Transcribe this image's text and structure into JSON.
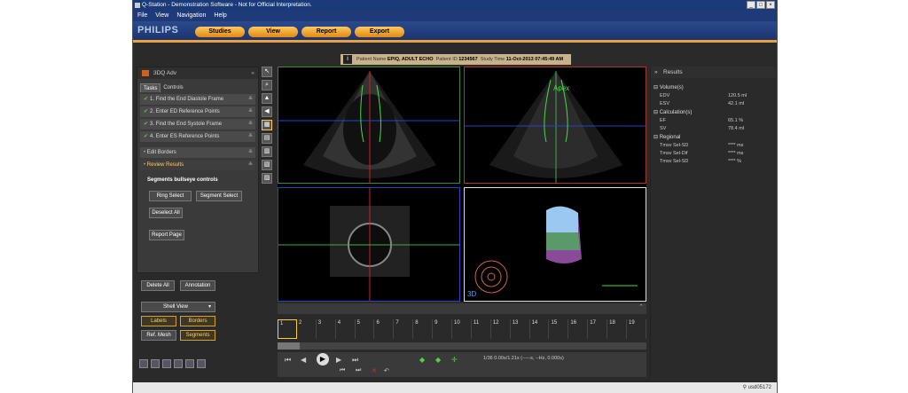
{
  "window": {
    "title": "Q-Station - Demonstration Software - Not for Official Interpretation."
  },
  "menu": [
    "File",
    "View",
    "Navigation",
    "Help"
  ],
  "brand": {
    "logo": "PHILIPS"
  },
  "main_tabs": [
    "Studies",
    "View",
    "Report",
    "Export"
  ],
  "patient": {
    "name_label": "Patient Name",
    "name": "EPIQ, ADULT ECHO",
    "id_label": "Patient ID",
    "id": "1234567",
    "time_label": "Study Time",
    "time": "11-Oct-2013 07:45:49 AM"
  },
  "left_panel": {
    "title": "3DQ Adv",
    "tabs": [
      "Tasks",
      "Controls"
    ],
    "tasks": [
      "1. Find the End Diastole Frame",
      "2. Enter ED Reference Points",
      "3. Find the End Systole Frame",
      "4. Enter ES Reference Points"
    ],
    "edit_borders": "Edit Borders",
    "review_results": "Review Results",
    "segments_label": "Segments bullseye controls",
    "buttons": {
      "ring_select": "Ring Select",
      "segment_select": "Segment Select",
      "deselect_all": "Deselect All",
      "report_page": "Report Page"
    }
  },
  "lower_controls": {
    "delete_all": "Delete All",
    "annotation": "Annotation",
    "shell_view": "Shell View",
    "labels": "Labels",
    "borders": "Borders",
    "ref_mesh": "Ref. Mesh",
    "segments": "Segments"
  },
  "viewer": {
    "apex_label": "Apex",
    "mode_label": "3D"
  },
  "results": {
    "title": "Results",
    "sections": [
      {
        "name": "Volume(s)",
        "rows": [
          {
            "k": "EDV",
            "v": "120.5 ml"
          },
          {
            "k": "ESV",
            "v": "42.1 ml"
          }
        ]
      },
      {
        "name": "Calculation(s)",
        "rows": [
          {
            "k": "EF",
            "v": "65.1 %"
          },
          {
            "k": "SV",
            "v": "78.4 ml"
          }
        ]
      },
      {
        "name": "Regional",
        "rows": [
          {
            "k": "Tmsv Sel-SD",
            "v": "**** ms"
          },
          {
            "k": "Tmsv Sel-Dif",
            "v": "**** ms"
          },
          {
            "k": "Tmsv Sel-SD",
            "v": "**** %"
          }
        ]
      }
    ]
  },
  "timeline": {
    "frames": [
      "1",
      "2",
      "3",
      "4",
      "5",
      "6",
      "7",
      "8",
      "9",
      "10",
      "11",
      "12",
      "13",
      "14",
      "15",
      "16",
      "17",
      "18",
      "19"
    ],
    "selected_frame": "1",
    "readout": "1/36  0.00s/1.21s (-----s, --Hz, 0.000s)"
  },
  "status": {
    "user": "usd05172"
  },
  "colors": {
    "accent": "#e8a040",
    "menu": "#1e3a78",
    "green": "#5ccc44"
  }
}
